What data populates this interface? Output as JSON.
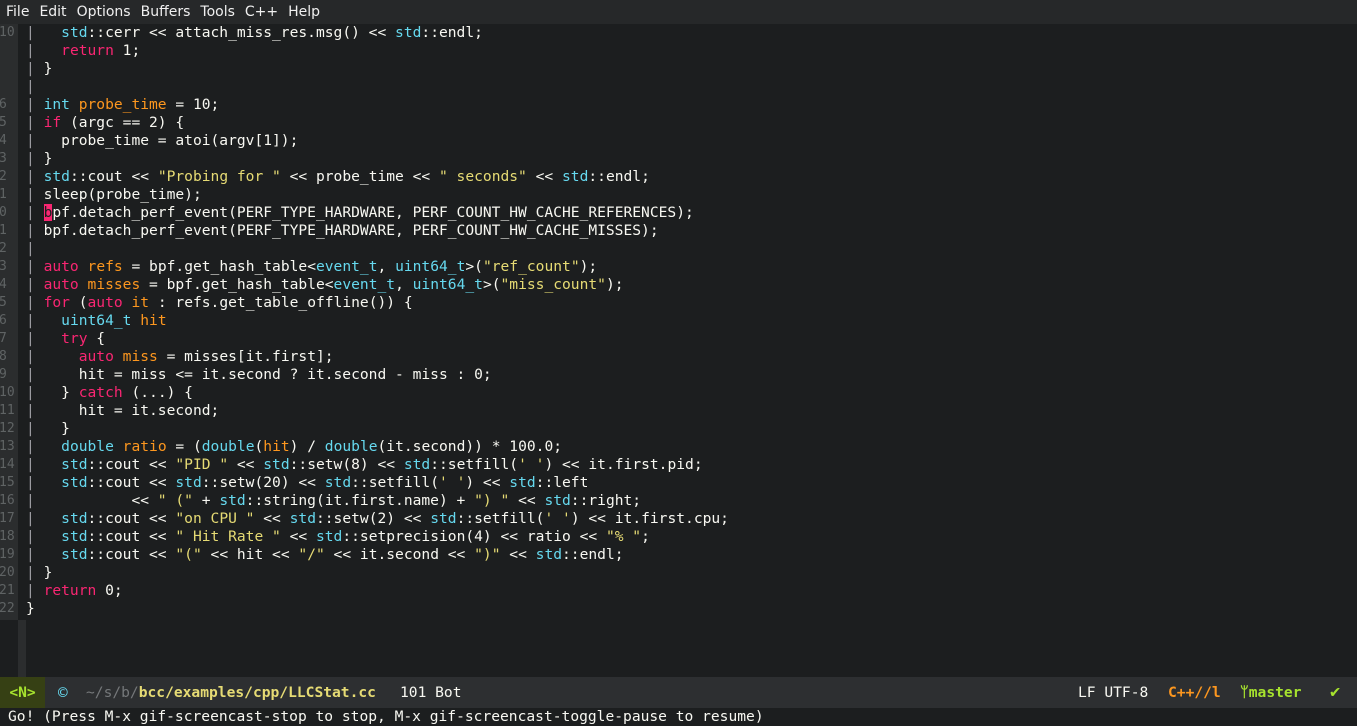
{
  "menu": [
    "File",
    "Edit",
    "Options",
    "Buffers",
    "Tools",
    "C++",
    "Help"
  ],
  "editor": {
    "lines": [
      {
        "ln": "10",
        "tokens": [
          [
            "g",
            "|   "
          ],
          [
            "t",
            "std"
          ],
          [
            "",
            "::cerr << attach_miss_res.msg() << "
          ],
          [
            "t",
            "std"
          ],
          [
            "",
            "::endl;"
          ]
        ]
      },
      {
        "ln": "",
        "tokens": [
          [
            "g",
            "|   "
          ],
          [
            "k",
            "return"
          ],
          [
            "",
            " 1;"
          ]
        ]
      },
      {
        "ln": "",
        "tokens": [
          [
            "g",
            "| "
          ],
          [
            "",
            "}"
          ]
        ]
      },
      {
        "ln": "",
        "tokens": [
          [
            "g",
            "|"
          ]
        ]
      },
      {
        "ln": "6",
        "tokens": [
          [
            "g",
            "| "
          ],
          [
            "t",
            "int"
          ],
          [
            "",
            " "
          ],
          [
            "v",
            "probe_time"
          ],
          [
            "",
            " = 10;"
          ]
        ]
      },
      {
        "ln": "5",
        "tokens": [
          [
            "g",
            "| "
          ],
          [
            "k",
            "if"
          ],
          [
            "",
            " (argc == 2) {"
          ]
        ]
      },
      {
        "ln": "4",
        "tokens": [
          [
            "g",
            "|   "
          ],
          [
            "",
            "probe_time = atoi(argv[1]);"
          ]
        ]
      },
      {
        "ln": "3",
        "tokens": [
          [
            "g",
            "| "
          ],
          [
            "",
            "}"
          ]
        ]
      },
      {
        "ln": "2",
        "tokens": [
          [
            "g",
            "| "
          ],
          [
            "t",
            "std"
          ],
          [
            "",
            "::cout << "
          ],
          [
            "s",
            "\"Probing for \""
          ],
          [
            "",
            " << probe_time << "
          ],
          [
            "s",
            "\" seconds\""
          ],
          [
            "",
            " << "
          ],
          [
            "t",
            "std"
          ],
          [
            "",
            "::endl;"
          ]
        ]
      },
      {
        "ln": "1",
        "tokens": [
          [
            "g",
            "| "
          ],
          [
            "",
            "sleep(probe_time);"
          ]
        ]
      },
      {
        "ln": "0",
        "tokens": [
          [
            "g",
            "| "
          ],
          [
            "cursor",
            "b"
          ],
          [
            "",
            "pf.detach_perf_event(PERF_TYPE_HARDWARE, PERF_COUNT_HW_CACHE_REFERENCES);"
          ]
        ]
      },
      {
        "ln": "1",
        "tokens": [
          [
            "g",
            "| "
          ],
          [
            "",
            "bpf.detach_perf_event(PERF_TYPE_HARDWARE, PERF_COUNT_HW_CACHE_MISSES);"
          ]
        ]
      },
      {
        "ln": "2",
        "tokens": [
          [
            "g",
            "|"
          ]
        ]
      },
      {
        "ln": "3",
        "tokens": [
          [
            "g",
            "| "
          ],
          [
            "k",
            "auto"
          ],
          [
            "",
            " "
          ],
          [
            "v",
            "refs"
          ],
          [
            "",
            " = bpf.get_hash_table<"
          ],
          [
            "t",
            "event_t"
          ],
          [
            "",
            ", "
          ],
          [
            "t",
            "uint64_t"
          ],
          [
            "",
            ">("
          ],
          [
            "s",
            "\"ref_count\""
          ],
          [
            "",
            ");"
          ]
        ]
      },
      {
        "ln": "4",
        "tokens": [
          [
            "g",
            "| "
          ],
          [
            "k",
            "auto"
          ],
          [
            "",
            " "
          ],
          [
            "v",
            "misses"
          ],
          [
            "",
            " = bpf.get_hash_table<"
          ],
          [
            "t",
            "event_t"
          ],
          [
            "",
            ", "
          ],
          [
            "t",
            "uint64_t"
          ],
          [
            "",
            ">("
          ],
          [
            "s",
            "\"miss_count\""
          ],
          [
            "",
            ");"
          ]
        ]
      },
      {
        "ln": "5",
        "tokens": [
          [
            "g",
            "| "
          ],
          [
            "k",
            "for"
          ],
          [
            "",
            " ("
          ],
          [
            "k",
            "auto"
          ],
          [
            "",
            " "
          ],
          [
            "v",
            "it"
          ],
          [
            "",
            " : refs.get_table_offline()) {"
          ]
        ]
      },
      {
        "ln": "6",
        "tokens": [
          [
            "g",
            "|   "
          ],
          [
            "t",
            "uint64_t"
          ],
          [
            "",
            " "
          ],
          [
            "v",
            "hit"
          ],
          [
            ";"
          ]
        ]
      },
      {
        "ln": "7",
        "tokens": [
          [
            "g",
            "|   "
          ],
          [
            "k",
            "try"
          ],
          [
            "",
            " {"
          ]
        ]
      },
      {
        "ln": "8",
        "tokens": [
          [
            "g",
            "|     "
          ],
          [
            "k",
            "auto"
          ],
          [
            "",
            " "
          ],
          [
            "v",
            "miss"
          ],
          [
            "",
            " = misses[it.first];"
          ]
        ]
      },
      {
        "ln": "9",
        "tokens": [
          [
            "g",
            "|     "
          ],
          [
            "",
            "hit = miss <= it.second ? it.second - miss : 0;"
          ]
        ]
      },
      {
        "ln": "10",
        "tokens": [
          [
            "g",
            "|   "
          ],
          [
            "",
            "} "
          ],
          [
            "k",
            "catch"
          ],
          [
            "",
            " (...) {"
          ]
        ]
      },
      {
        "ln": "11",
        "tokens": [
          [
            "g",
            "|     "
          ],
          [
            "",
            "hit = it.second;"
          ]
        ]
      },
      {
        "ln": "12",
        "tokens": [
          [
            "g",
            "|   "
          ],
          [
            "",
            "}"
          ]
        ]
      },
      {
        "ln": "13",
        "tokens": [
          [
            "g",
            "|   "
          ],
          [
            "t",
            "double"
          ],
          [
            "",
            " "
          ],
          [
            "v",
            "ratio"
          ],
          [
            "",
            " = ("
          ],
          [
            "t",
            "double"
          ],
          [
            "",
            "("
          ],
          [
            "v",
            "hit"
          ],
          [
            "",
            ") / "
          ],
          [
            "t",
            "double"
          ],
          [
            "",
            "(it.second)) * 100.0;"
          ]
        ]
      },
      {
        "ln": "14",
        "tokens": [
          [
            "g",
            "|   "
          ],
          [
            "t",
            "std"
          ],
          [
            "",
            "::cout << "
          ],
          [
            "s",
            "\"PID \""
          ],
          [
            "",
            " << "
          ],
          [
            "t",
            "std"
          ],
          [
            "",
            "::setw(8) << "
          ],
          [
            "t",
            "std"
          ],
          [
            "",
            "::setfill("
          ],
          [
            "s",
            "' '"
          ],
          [
            "",
            ") << it.first.pid;"
          ]
        ]
      },
      {
        "ln": "15",
        "tokens": [
          [
            "g",
            "|   "
          ],
          [
            "t",
            "std"
          ],
          [
            "",
            "::cout << "
          ],
          [
            "t",
            "std"
          ],
          [
            "",
            "::setw(20) << "
          ],
          [
            "t",
            "std"
          ],
          [
            "",
            "::setfill("
          ],
          [
            "s",
            "' '"
          ],
          [
            "",
            ") << "
          ],
          [
            "t",
            "std"
          ],
          [
            "",
            "::left"
          ]
        ]
      },
      {
        "ln": "16",
        "tokens": [
          [
            "g",
            "|           "
          ],
          [
            "",
            "<< "
          ],
          [
            "s",
            "\" (\""
          ],
          [
            "",
            " + "
          ],
          [
            "t",
            "std"
          ],
          [
            "",
            "::string(it.first.name) + "
          ],
          [
            "s",
            "\") \""
          ],
          [
            "",
            " << "
          ],
          [
            "t",
            "std"
          ],
          [
            "",
            "::right;"
          ]
        ]
      },
      {
        "ln": "17",
        "tokens": [
          [
            "g",
            "|   "
          ],
          [
            "t",
            "std"
          ],
          [
            "",
            "::cout << "
          ],
          [
            "s",
            "\"on CPU \""
          ],
          [
            "",
            " << "
          ],
          [
            "t",
            "std"
          ],
          [
            "",
            "::setw(2) << "
          ],
          [
            "t",
            "std"
          ],
          [
            "",
            "::setfill("
          ],
          [
            "s",
            "' '"
          ],
          [
            "",
            ") << it.first.cpu;"
          ]
        ]
      },
      {
        "ln": "18",
        "tokens": [
          [
            "g",
            "|   "
          ],
          [
            "t",
            "std"
          ],
          [
            "",
            "::cout << "
          ],
          [
            "s",
            "\" Hit Rate \""
          ],
          [
            "",
            " << "
          ],
          [
            "t",
            "std"
          ],
          [
            "",
            "::setprecision(4) << ratio << "
          ],
          [
            "s",
            "\"% \""
          ],
          [
            "",
            ";"
          ]
        ]
      },
      {
        "ln": "19",
        "tokens": [
          [
            "g",
            "|   "
          ],
          [
            "t",
            "std"
          ],
          [
            "",
            "::cout << "
          ],
          [
            "s",
            "\"(\""
          ],
          [
            "",
            " << hit << "
          ],
          [
            "s",
            "\"/\""
          ],
          [
            "",
            " << it.second << "
          ],
          [
            "s",
            "\")\""
          ],
          [
            "",
            " << "
          ],
          [
            "t",
            "std"
          ],
          [
            "",
            "::endl;"
          ]
        ]
      },
      {
        "ln": "20",
        "tokens": [
          [
            "g",
            "| "
          ],
          [
            "",
            "}"
          ]
        ]
      },
      {
        "ln": "21",
        "tokens": [
          [
            "g",
            "| "
          ],
          [
            "k",
            "return"
          ],
          [
            "",
            " 0;"
          ]
        ]
      },
      {
        "ln": "22",
        "tokens": [
          [
            "",
            "}"
          ]
        ]
      }
    ]
  },
  "modeline": {
    "state": "<N>",
    "icon": "cpp-file-icon",
    "path_dim": "~/s/b/",
    "path_file": "bcc/examples/cpp/LLCStat.cc",
    "position": "101 Bot",
    "encoding": "LF UTF-8",
    "major_mode": "C++//l",
    "branch": "master"
  },
  "echo": "Go! (Press M-x gif-screencast-stop to stop, M-x gif-screencast-toggle-pause to resume)",
  "colors": {
    "background": "#1c1e1f",
    "keyword": "#f92672",
    "type": "#66d9ef",
    "variable": "#fd971f",
    "string": "#e6db74",
    "ok": "#a6e22e"
  }
}
